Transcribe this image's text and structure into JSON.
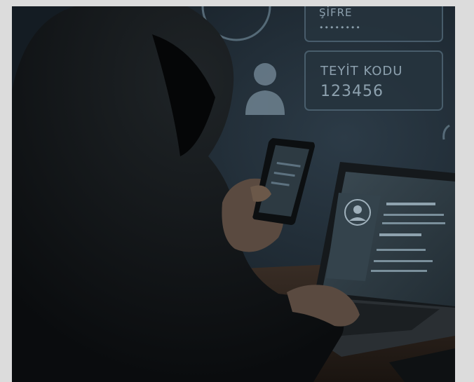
{
  "scene": {
    "description_kind": "photo",
    "hologram": {
      "password_label": "ŞİFRE",
      "password_mask": "••••••••",
      "code_label": "TEYİT KODU",
      "code_value": "123456"
    },
    "colors": {
      "background": "#1b2630",
      "hologram": "#9fb4c2",
      "laptop_screen": "#2b3840"
    }
  }
}
